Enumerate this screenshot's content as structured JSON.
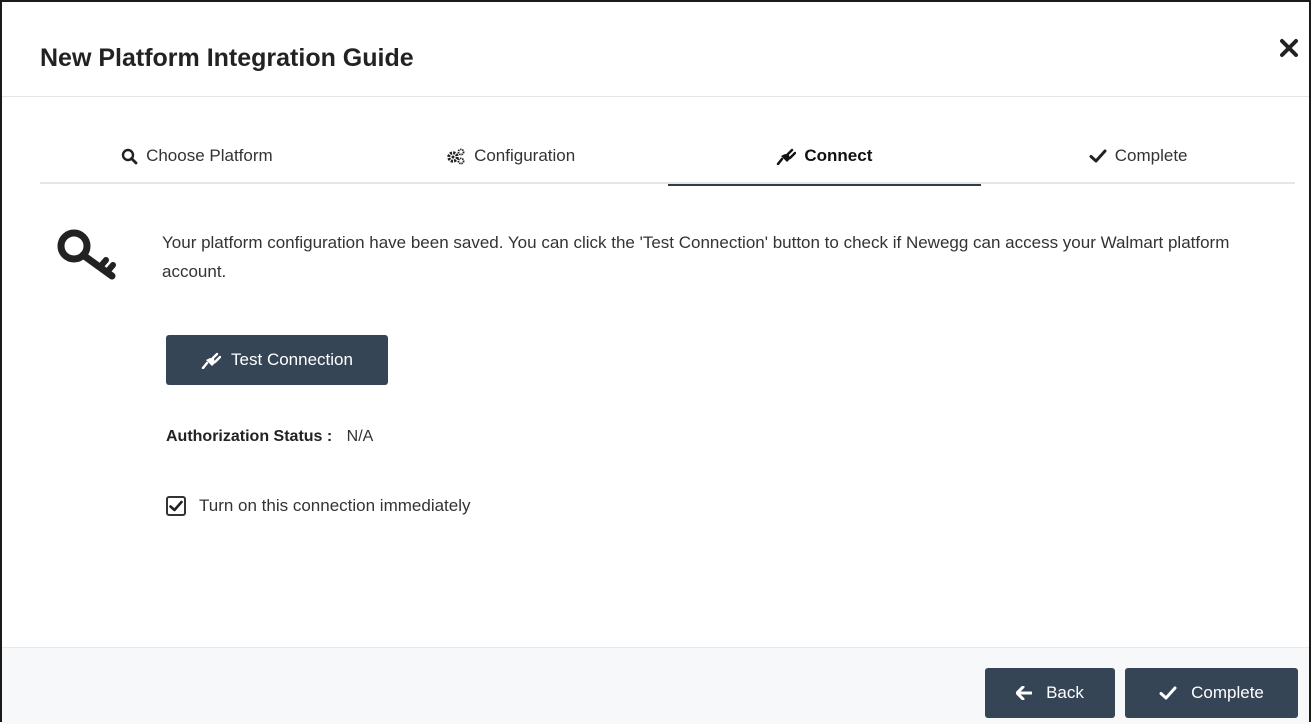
{
  "modal": {
    "title": "New Platform Integration Guide",
    "close_icon": "close-icon"
  },
  "tabs": [
    {
      "label": "Choose Platform",
      "icon": "search-icon",
      "active": false
    },
    {
      "label": "Configuration",
      "icon": "gears-icon",
      "active": false
    },
    {
      "label": "Connect",
      "icon": "plug-icon",
      "active": true
    },
    {
      "label": "Complete",
      "icon": "check-icon",
      "active": false
    }
  ],
  "connect": {
    "icon": "key-icon",
    "message": "Your platform configuration have been saved. You can click the 'Test Connection' button to check if Newegg can access your Walmart platform account.",
    "test_button_label": "Test Connection",
    "auth_status_label": "Authorization Status :",
    "auth_status_value": "N/A",
    "checkbox_label": "Turn on this connection immediately",
    "checkbox_checked": true
  },
  "footer": {
    "back_label": "Back",
    "complete_label": "Complete"
  },
  "colors": {
    "button_bg": "#354556",
    "active_tab_underline": "#333b47",
    "footer_bg": "#f7f8fa"
  }
}
